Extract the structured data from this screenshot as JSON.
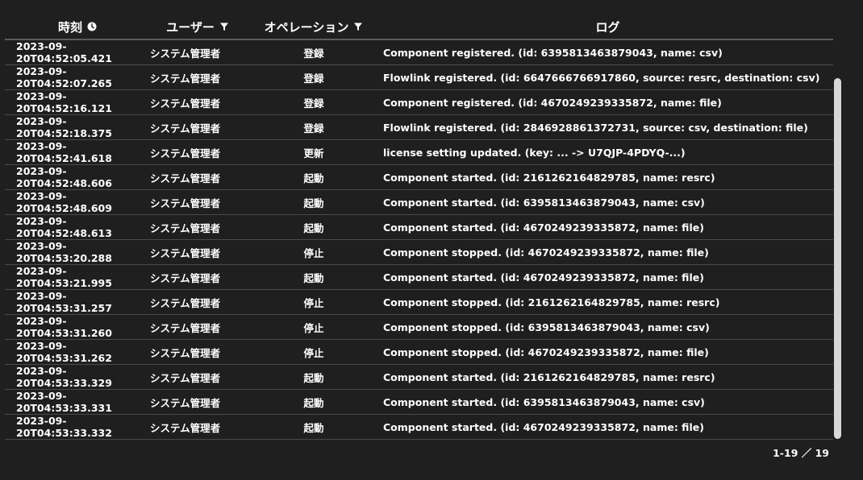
{
  "columns": {
    "time": "時刻",
    "user": "ユーザー",
    "operation": "オペレーション",
    "log": "ログ"
  },
  "icons": {
    "time_sort": "clock-icon",
    "user_filter": "filter-icon",
    "operation_filter": "filter-icon"
  },
  "rows": [
    {
      "time": "2023-09-20T04:52:05.421",
      "user": "システム管理者",
      "op": "登録",
      "log": "Component registered. (id: 6395813463879043, name: csv)"
    },
    {
      "time": "2023-09-20T04:52:07.265",
      "user": "システム管理者",
      "op": "登録",
      "log": "Flowlink registered. (id: 6647666766917860, source: resrc, destination: csv)"
    },
    {
      "time": "2023-09-20T04:52:16.121",
      "user": "システム管理者",
      "op": "登録",
      "log": "Component registered. (id: 4670249239335872, name: file)"
    },
    {
      "time": "2023-09-20T04:52:18.375",
      "user": "システム管理者",
      "op": "登録",
      "log": "Flowlink registered. (id: 2846928861372731, source: csv, destination: file)"
    },
    {
      "time": "2023-09-20T04:52:41.618",
      "user": "システム管理者",
      "op": "更新",
      "log": "license setting updated. (key: ... -> U7QJP-4PDYQ-...)"
    },
    {
      "time": "2023-09-20T04:52:48.606",
      "user": "システム管理者",
      "op": "起動",
      "log": "Component started. (id: 2161262164829785, name: resrc)"
    },
    {
      "time": "2023-09-20T04:52:48.609",
      "user": "システム管理者",
      "op": "起動",
      "log": "Component started. (id: 6395813463879043, name: csv)"
    },
    {
      "time": "2023-09-20T04:52:48.613",
      "user": "システム管理者",
      "op": "起動",
      "log": "Component started. (id: 4670249239335872, name: file)"
    },
    {
      "time": "2023-09-20T04:53:20.288",
      "user": "システム管理者",
      "op": "停止",
      "log": "Component stopped. (id: 4670249239335872, name: file)"
    },
    {
      "time": "2023-09-20T04:53:21.995",
      "user": "システム管理者",
      "op": "起動",
      "log": "Component started. (id: 4670249239335872, name: file)"
    },
    {
      "time": "2023-09-20T04:53:31.257",
      "user": "システム管理者",
      "op": "停止",
      "log": "Component stopped. (id: 2161262164829785, name: resrc)"
    },
    {
      "time": "2023-09-20T04:53:31.260",
      "user": "システム管理者",
      "op": "停止",
      "log": "Component stopped. (id: 6395813463879043, name: csv)"
    },
    {
      "time": "2023-09-20T04:53:31.262",
      "user": "システム管理者",
      "op": "停止",
      "log": "Component stopped. (id: 4670249239335872, name: file)"
    },
    {
      "time": "2023-09-20T04:53:33.329",
      "user": "システム管理者",
      "op": "起動",
      "log": "Component started. (id: 2161262164829785, name: resrc)"
    },
    {
      "time": "2023-09-20T04:53:33.331",
      "user": "システム管理者",
      "op": "起動",
      "log": "Component started. (id: 6395813463879043, name: csv)"
    },
    {
      "time": "2023-09-20T04:53:33.332",
      "user": "システム管理者",
      "op": "起動",
      "log": "Component started. (id: 4670249239335872, name: file)"
    }
  ],
  "pagination": "1-19 ／ 19"
}
